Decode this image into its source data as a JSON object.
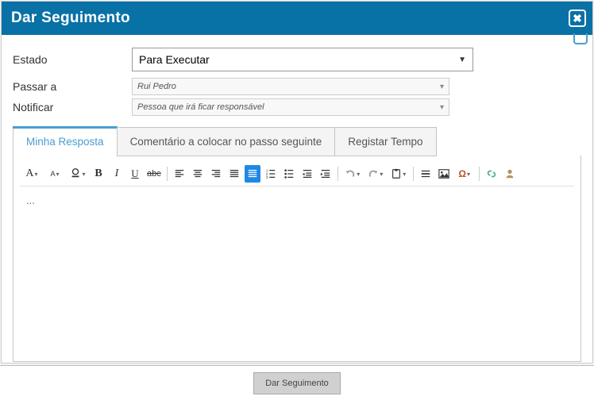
{
  "header": {
    "title": "Dar Seguimento"
  },
  "form": {
    "estado_label": "Estado",
    "estado_value": "Para Executar",
    "passar_label": "Passar a",
    "passar_value": "Rui Pedro",
    "notificar_label": "Notificar",
    "notificar_placeholder": "Pessoa que irá ficar responsável"
  },
  "tabs": [
    {
      "label": "Minha Resposta",
      "active": true
    },
    {
      "label": "Comentário a colocar no passo seguinte",
      "active": false
    },
    {
      "label": "Registar Tempo",
      "active": false
    }
  ],
  "toolbar": {
    "font_letter": "A",
    "bold": "B",
    "italic": "I",
    "underline": "U",
    "strike": "abc"
  },
  "editor": {
    "content": "..."
  },
  "footer": {
    "submit_label": "Dar Seguimento"
  }
}
